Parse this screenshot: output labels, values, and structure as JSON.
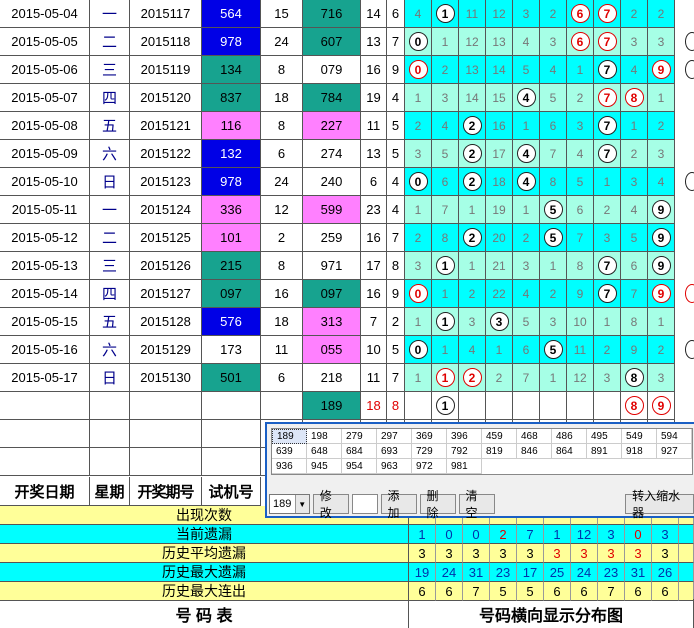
{
  "rows": [
    {
      "date": "2015-05-04",
      "week": "一",
      "period": "2015117",
      "kj": "564",
      "kjc": "blue",
      "sum1": "15",
      "sj": "716",
      "sjc": "teal",
      "s1": "14",
      "s2": "6",
      "s2c": "blk",
      "t": [
        "4",
        "1",
        "11",
        "12",
        "3",
        "2",
        "6",
        "7",
        "2",
        "2"
      ],
      "balls": [
        1,
        6,
        7
      ],
      "red": [
        6,
        7
      ],
      "partial": ""
    },
    {
      "date": "2015-05-05",
      "week": "二",
      "period": "2015118",
      "kj": "978",
      "kjc": "blue",
      "sum1": "24",
      "sj": "607",
      "sjc": "teal",
      "s1": "13",
      "s2": "7",
      "s2c": "blk",
      "t": [
        "0",
        "1",
        "12",
        "13",
        "4",
        "3",
        "6",
        "7",
        "3",
        "3"
      ],
      "balls": [
        0,
        6,
        7
      ],
      "red": [
        6,
        7
      ],
      "partial": "b"
    },
    {
      "date": "2015-05-06",
      "week": "三",
      "period": "2015119",
      "kj": "134",
      "kjc": "teal",
      "sum1": "8",
      "sj": "079",
      "sjc": "",
      "s1": "16",
      "s2": "9",
      "s2c": "blk",
      "t": [
        "0",
        "2",
        "13",
        "14",
        "5",
        "4",
        "1",
        "7",
        "4",
        "9"
      ],
      "balls": [
        0,
        7,
        9
      ],
      "red": [
        0,
        9
      ],
      "partial": "b"
    },
    {
      "date": "2015-05-07",
      "week": "四",
      "period": "2015120",
      "kj": "837",
      "kjc": "teal",
      "sum1": "18",
      "sj": "784",
      "sjc": "teal",
      "s1": "19",
      "s2": "4",
      "s2c": "blk",
      "t": [
        "1",
        "3",
        "14",
        "15",
        "4",
        "5",
        "2",
        "7",
        "8",
        "1"
      ],
      "balls": [
        4,
        7,
        8
      ],
      "red": [
        7,
        8
      ],
      "partial": ""
    },
    {
      "date": "2015-05-08",
      "week": "五",
      "period": "2015121",
      "kj": "116",
      "kjc": "pink",
      "sum1": "8",
      "sj": "227",
      "sjc": "pink",
      "s1": "11",
      "s2": "5",
      "s2c": "blk",
      "t": [
        "2",
        "4",
        "2",
        "16",
        "1",
        "6",
        "3",
        "7",
        "1",
        "2"
      ],
      "balls": [
        2,
        7
      ],
      "red": [],
      "partial": ""
    },
    {
      "date": "2015-05-09",
      "week": "六",
      "period": "2015122",
      "kj": "132",
      "kjc": "blue",
      "sum1": "6",
      "sj": "274",
      "sjc": "",
      "s1": "13",
      "s2": "5",
      "s2c": "blk",
      "t": [
        "3",
        "5",
        "2",
        "17",
        "4",
        "7",
        "4",
        "7",
        "2",
        "3"
      ],
      "balls": [
        2,
        4,
        7
      ],
      "red": [],
      "partial": ""
    },
    {
      "date": "2015-05-10",
      "week": "日",
      "period": "2015123",
      "kj": "978",
      "kjc": "blue",
      "sum1": "24",
      "sj": "240",
      "sjc": "",
      "s1": "6",
      "s2": "4",
      "s2c": "blk",
      "t": [
        "0",
        "6",
        "2",
        "18",
        "4",
        "8",
        "5",
        "1",
        "3",
        "4"
      ],
      "balls": [
        0,
        2,
        4
      ],
      "red": [],
      "partial": "b"
    },
    {
      "date": "2015-05-11",
      "week": "一",
      "period": "2015124",
      "kj": "336",
      "kjc": "pink",
      "sum1": "12",
      "sj": "599",
      "sjc": "pink",
      "s1": "23",
      "s2": "4",
      "s2c": "blk",
      "t": [
        "1",
        "7",
        "1",
        "19",
        "1",
        "5",
        "6",
        "2",
        "4",
        "9"
      ],
      "balls": [
        5,
        9
      ],
      "red": [],
      "partial": ""
    },
    {
      "date": "2015-05-12",
      "week": "二",
      "period": "2015125",
      "kj": "101",
      "kjc": "pink",
      "sum1": "2",
      "sj": "259",
      "sjc": "",
      "s1": "16",
      "s2": "7",
      "s2c": "blk",
      "t": [
        "2",
        "8",
        "2",
        "20",
        "2",
        "5",
        "7",
        "3",
        "5",
        "9"
      ],
      "balls": [
        2,
        5,
        9
      ],
      "red": [],
      "partial": ""
    },
    {
      "date": "2015-05-13",
      "week": "三",
      "period": "2015126",
      "kj": "215",
      "kjc": "teal",
      "sum1": "8",
      "sj": "971",
      "sjc": "",
      "s1": "17",
      "s2": "8",
      "s2c": "blk",
      "t": [
        "3",
        "1",
        "1",
        "21",
        "3",
        "1",
        "8",
        "7",
        "6",
        "9"
      ],
      "balls": [
        1,
        7,
        9
      ],
      "red": [],
      "partial": ""
    },
    {
      "date": "2015-05-14",
      "week": "四",
      "period": "2015127",
      "kj": "097",
      "kjc": "teal",
      "sum1": "16",
      "sj": "097",
      "sjc": "teal",
      "s1": "16",
      "s2": "9",
      "s2c": "blk",
      "t": [
        "0",
        "1",
        "2",
        "22",
        "4",
        "2",
        "9",
        "7",
        "7",
        "9"
      ],
      "balls": [
        0,
        7,
        9
      ],
      "red": [
        0,
        9
      ],
      "partial": "r"
    },
    {
      "date": "2015-05-15",
      "week": "五",
      "period": "2015128",
      "kj": "576",
      "kjc": "blue",
      "sum1": "18",
      "sj": "313",
      "sjc": "pink",
      "s1": "7",
      "s2": "2",
      "s2c": "blk",
      "t": [
        "1",
        "1",
        "3",
        "3",
        "5",
        "3",
        "10",
        "1",
        "8",
        "1"
      ],
      "balls": [
        1,
        3
      ],
      "red": [],
      "partial": ""
    },
    {
      "date": "2015-05-16",
      "week": "六",
      "period": "2015129",
      "kj": "173",
      "kjc": "",
      "sum1": "11",
      "sj": "055",
      "sjc": "pink",
      "s1": "10",
      "s2": "5",
      "s2c": "blk",
      "t": [
        "0",
        "1",
        "4",
        "1",
        "6",
        "5",
        "11",
        "2",
        "9",
        "2"
      ],
      "balls": [
        0,
        5
      ],
      "red": [],
      "partial": "b"
    },
    {
      "date": "2015-05-17",
      "week": "日",
      "period": "2015130",
      "kj": "501",
      "kjc": "teal",
      "sum1": "6",
      "sj": "218",
      "sjc": "",
      "s1": "11",
      "s2": "7",
      "s2c": "blk",
      "t": [
        "1",
        "1",
        "2",
        "2",
        "7",
        "1",
        "12",
        "3",
        "8",
        "3"
      ],
      "balls": [
        1,
        2,
        8
      ],
      "red": [
        1,
        2
      ],
      "partial": ""
    }
  ],
  "pending": {
    "sj": "189",
    "s1": "18",
    "s2": "8",
    "balls": [
      1,
      8,
      9
    ],
    "red": [
      8,
      9
    ]
  },
  "popup": {
    "numbers": [
      "189",
      "198",
      "279",
      "297",
      "369",
      "396",
      "459",
      "468",
      "486",
      "495",
      "549",
      "594",
      "639",
      "648",
      "684",
      "693",
      "729",
      "792",
      "819",
      "846",
      "864",
      "891",
      "918",
      "927",
      "936",
      "945",
      "954",
      "963",
      "972",
      "981"
    ],
    "selected": "189",
    "modify": "修改",
    "add": "添加",
    "del": "删除",
    "clear": "清空",
    "to_reducer": "转入缩水器"
  },
  "headers": {
    "date": "开奖日期",
    "week": "星期",
    "kj": "开奖期号",
    "sj": "试机号"
  },
  "stats": [
    {
      "label": "出现次数",
      "bg": "y",
      "vals": []
    },
    {
      "label": "当前遗漏",
      "bg": "cy",
      "vals": [
        "1",
        "0",
        "0",
        "2",
        "7",
        "1",
        "12",
        "3",
        "0",
        "3"
      ],
      "redIdx": [
        3,
        8
      ]
    },
    {
      "label": "历史平均遗漏",
      "bg": "y",
      "vals": [
        "3",
        "3",
        "3",
        "3",
        "3",
        "3",
        "3",
        "3",
        "3",
        "3"
      ],
      "redIdx": [
        5,
        6,
        7,
        8
      ]
    },
    {
      "label": "历史最大遗漏",
      "bg": "cy",
      "vals": [
        "19",
        "24",
        "31",
        "23",
        "17",
        "25",
        "24",
        "23",
        "31",
        "26"
      ],
      "redIdx": []
    },
    {
      "label": "历史最大连出",
      "bg": "y",
      "vals": [
        "6",
        "6",
        "7",
        "5",
        "5",
        "6",
        "6",
        "7",
        "6",
        "6"
      ],
      "redIdx": []
    }
  ],
  "footer": {
    "left": "号  码  表",
    "right": "号码横向显示分布图"
  }
}
